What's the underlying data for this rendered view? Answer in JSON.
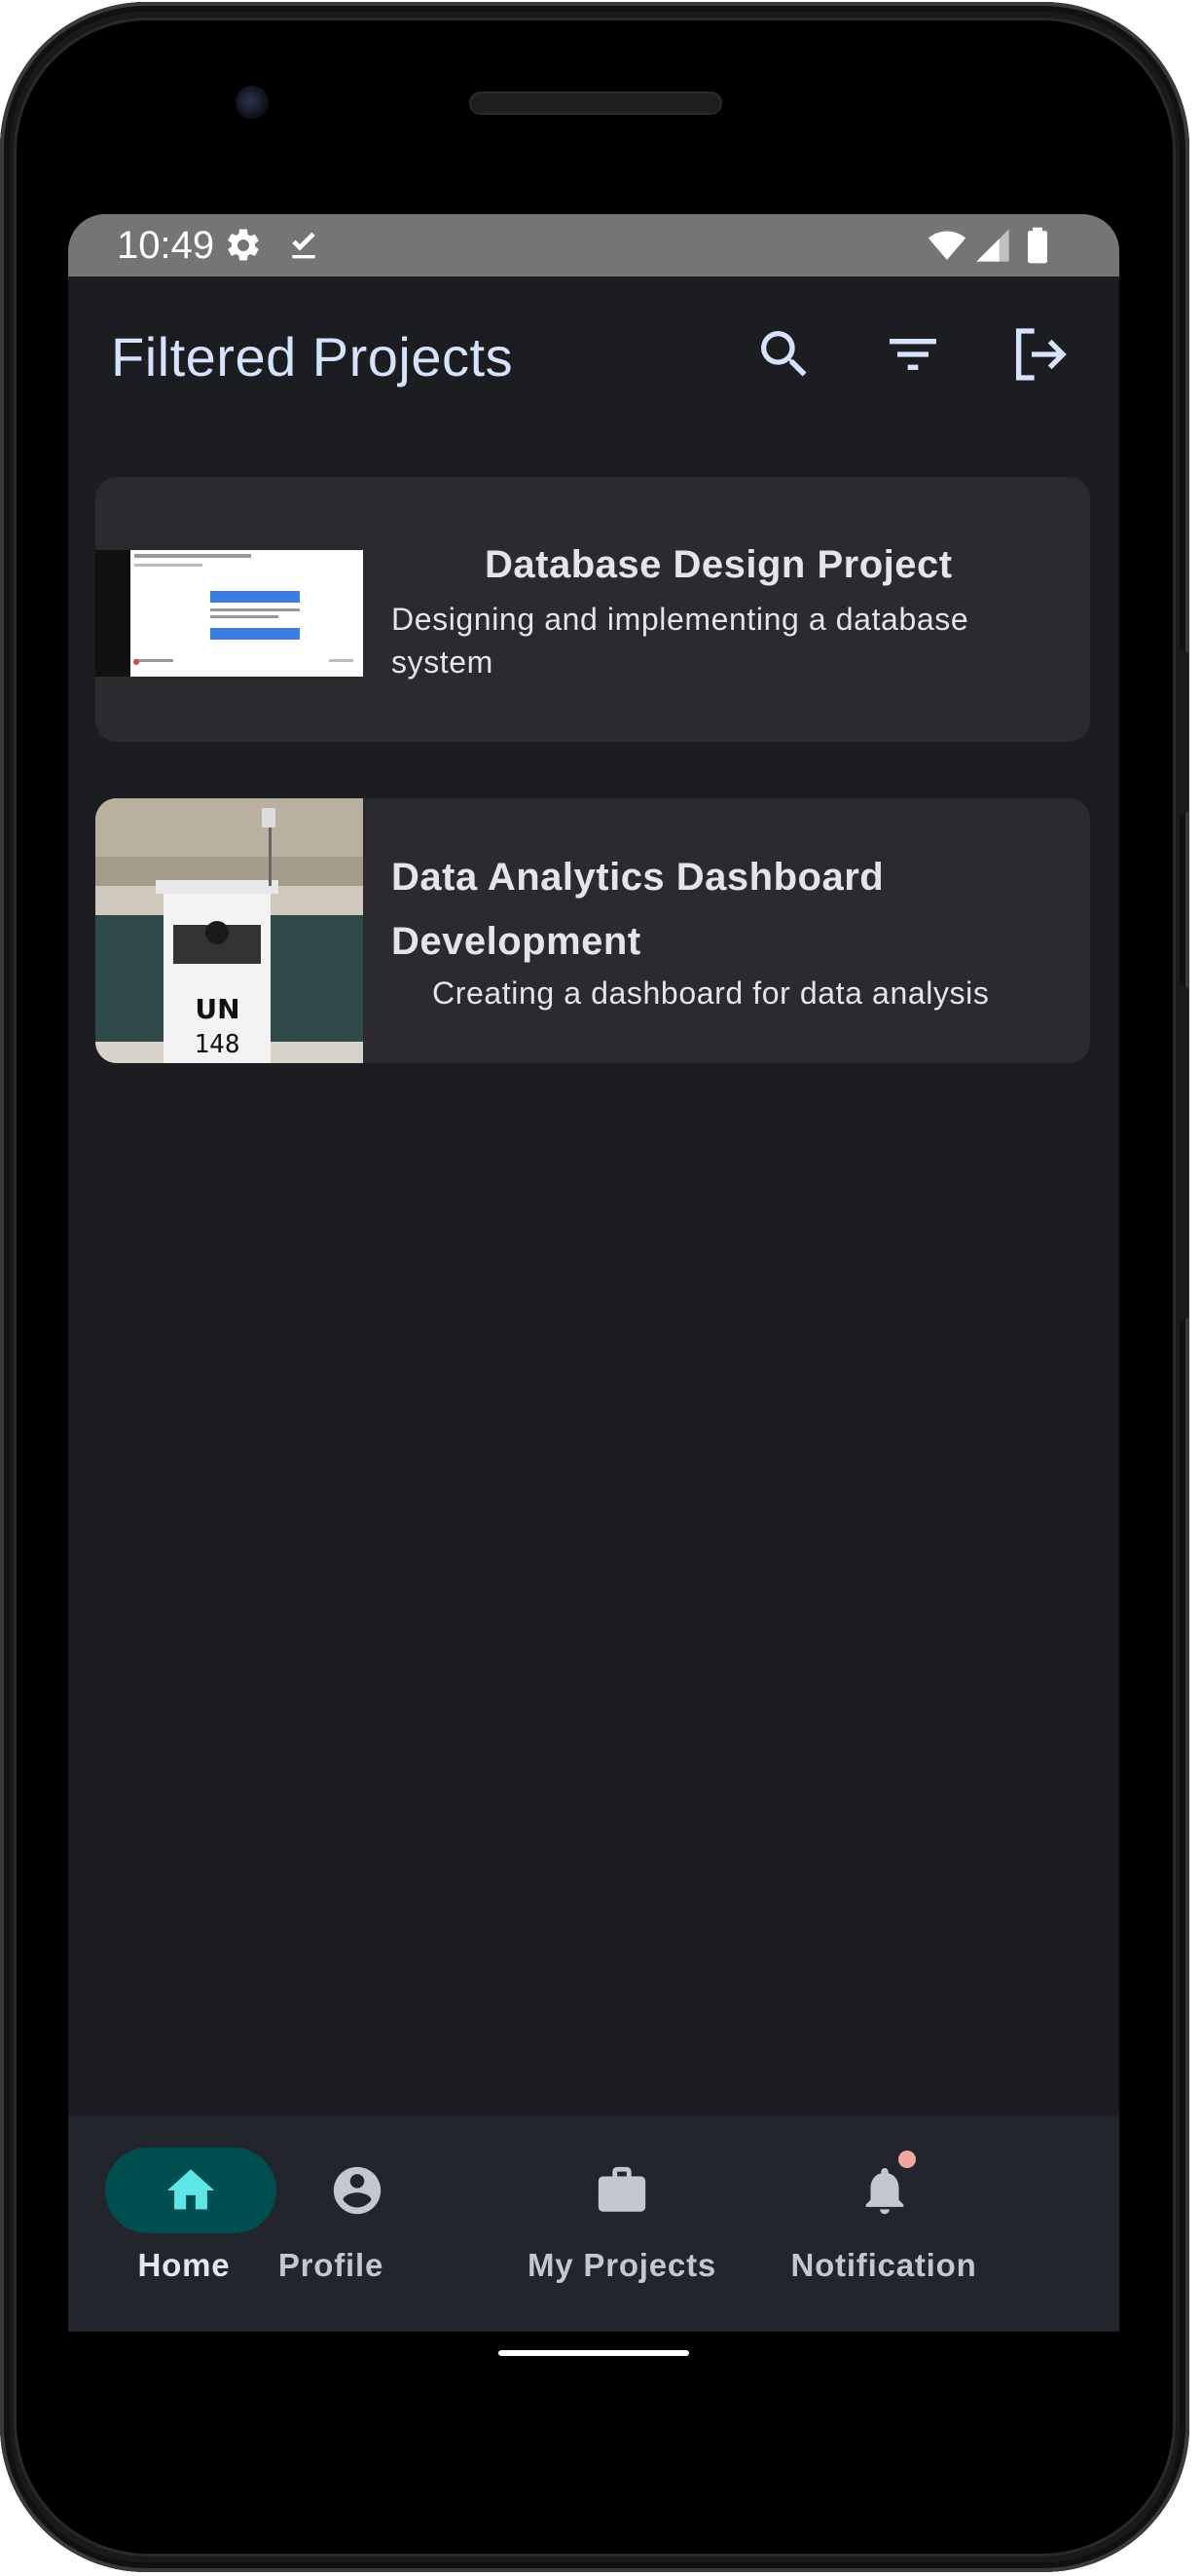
{
  "status_bar": {
    "time": "10:49",
    "icons_left": [
      "gear-icon",
      "download-done-icon"
    ],
    "icons_right": [
      "wifi-icon",
      "cell-signal-icon",
      "battery-icon"
    ]
  },
  "app_bar": {
    "title": "Filtered Projects",
    "actions": [
      "search-icon",
      "filter-icon",
      "logout-icon"
    ]
  },
  "projects": [
    {
      "title": "Database Design Project",
      "description": "Designing and implementing a database system",
      "thumbnail": "screenshot-thumbnail"
    },
    {
      "title": "Data Analytics Dashboard Development",
      "description": "Creating a dashboard for data analysis",
      "thumbnail": "photo-thumbnail",
      "thumbnail_text": [
        "UN",
        "148"
      ]
    }
  ],
  "bottom_nav": {
    "items": [
      {
        "label": "Home",
        "icon": "home-icon",
        "active": true
      },
      {
        "label": "Profile",
        "icon": "account-circle-icon",
        "active": false
      },
      {
        "label": "My Projects",
        "icon": "briefcase-icon",
        "active": false
      },
      {
        "label": "Notification",
        "icon": "bell-icon",
        "active": false,
        "badge": true
      }
    ]
  },
  "colors": {
    "accent": "#5ee6e6",
    "nav_active_pill": "#004f50",
    "background": "#1c1d20",
    "card": "#2b2a2e",
    "title": "#d6e3ff"
  }
}
